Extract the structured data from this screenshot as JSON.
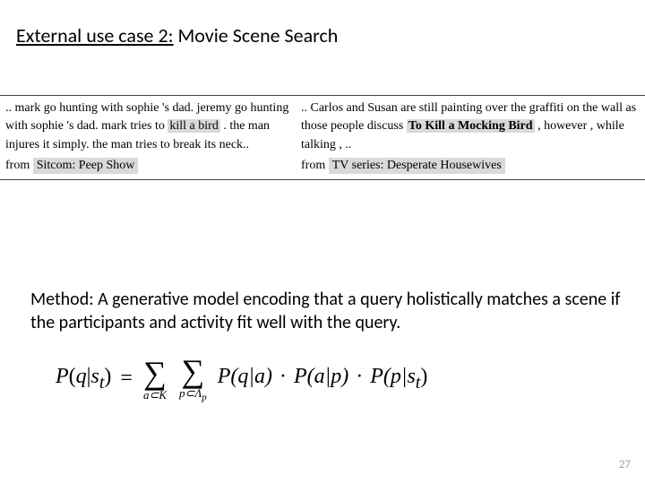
{
  "title": {
    "prefix": "External use case 2:",
    "rest": " Movie Scene Search"
  },
  "examples": {
    "left": {
      "pre": ".. mark go hunting with sophie 's dad.  jeremy go hunting with sophie 's dad.  mark tries to ",
      "hl": "kill a bird",
      "post": " .  the man injures it simply.  the man tries to break its neck..",
      "from_label": "from",
      "from_src": "Sitcom: Peep Show"
    },
    "right": {
      "pre": "..   Carlos   and   Susan   are   still   painting   over the   graffiti   on   the   wall   as   those   people   discuss ",
      "hl": "To Kill a Mocking Bird",
      "post": "  ,   however  ,   while   talking , ..",
      "from_label": "from",
      "from_src": "TV series: Desperate Housewives"
    }
  },
  "method": "Method: A generative model encoding that a query holistically matches a scene if the participants and activity fit well with the query.",
  "equation": {
    "lhs_P": "P",
    "lhs_open": "(",
    "lhs_q": "q",
    "lhs_bar": "|",
    "lhs_s": "s",
    "lhs_t": "t",
    "lhs_close": ")",
    "eq": " = ",
    "sum1_sub": "a⊂K",
    "sum2_sub_pre": "p⊂Λ",
    "sum2_sub_p": "p",
    "term1": "P(q|a)",
    "term2": "P(a|p)",
    "term3_pre": "P(p|s",
    "term3_t": "t",
    "term3_post": ")"
  },
  "page_number": "27"
}
